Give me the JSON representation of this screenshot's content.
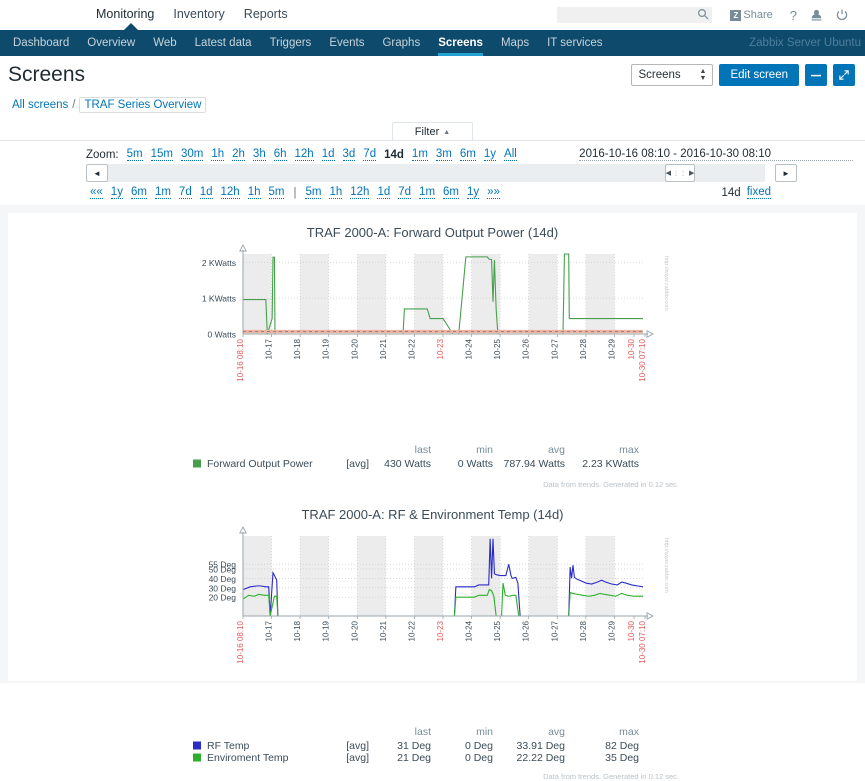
{
  "topnav": {
    "items": [
      {
        "label": "Monitoring",
        "active": true
      },
      {
        "label": "Inventory",
        "active": false
      },
      {
        "label": "Reports",
        "active": false
      }
    ],
    "search": {
      "value": "",
      "placeholder": ""
    },
    "share_label": "Share",
    "share_badge": "Z",
    "help_icon": "?",
    "user_icon": "user-icon",
    "power_icon": "power-icon"
  },
  "navbar": {
    "items": [
      {
        "label": "Dashboard",
        "active": false
      },
      {
        "label": "Overview",
        "active": false
      },
      {
        "label": "Web",
        "active": false
      },
      {
        "label": "Latest data",
        "active": false
      },
      {
        "label": "Triggers",
        "active": false
      },
      {
        "label": "Events",
        "active": false
      },
      {
        "label": "Graphs",
        "active": false
      },
      {
        "label": "Screens",
        "active": true
      },
      {
        "label": "Maps",
        "active": false
      },
      {
        "label": "IT services",
        "active": false
      }
    ],
    "server": "Zabbix Server Ubuntu"
  },
  "page": {
    "title": "Screens",
    "select_value": "Screens",
    "edit_button": "Edit screen",
    "collapse_icon": "minus-icon",
    "fullscreen_icon": "expand-icon"
  },
  "breadcrumb": {
    "all_screens": "All screens",
    "separator": "/",
    "current": "TRAF Series Overview"
  },
  "filter": {
    "tab_label": "Filter",
    "tab_caret": "▲",
    "zoom_label": "Zoom:",
    "zoom_options": [
      {
        "label": "5m",
        "current": false
      },
      {
        "label": "15m",
        "current": false
      },
      {
        "label": "30m",
        "current": false
      },
      {
        "label": "1h",
        "current": false
      },
      {
        "label": "2h",
        "current": false
      },
      {
        "label": "3h",
        "current": false
      },
      {
        "label": "6h",
        "current": false
      },
      {
        "label": "12h",
        "current": false
      },
      {
        "label": "1d",
        "current": false
      },
      {
        "label": "3d",
        "current": false
      },
      {
        "label": "7d",
        "current": false
      },
      {
        "label": "14d",
        "current": true
      },
      {
        "label": "1m",
        "current": false
      },
      {
        "label": "3m",
        "current": false
      },
      {
        "label": "6m",
        "current": false
      },
      {
        "label": "1y",
        "current": false
      },
      {
        "label": "All",
        "current": false
      }
    ],
    "period": "2016-10-16 08:10 - 2016-10-30 08:10",
    "scroll_left_icon": "◄",
    "scroll_right_icon": "►",
    "nav_back_all": "««",
    "nav_back": [
      "1y",
      "6m",
      "1m",
      "7d",
      "1d",
      "12h",
      "1h",
      "5m"
    ],
    "nav_divider": "|",
    "nav_fwd": [
      "5m",
      "1h",
      "12h",
      "1d",
      "7d",
      "1m",
      "6m",
      "1y"
    ],
    "nav_fwd_all": "»»",
    "current_range": "14d",
    "fixed_label": "fixed"
  },
  "chart_data": [
    {
      "type": "line",
      "title": "TRAF 2000-A: Forward Output Power (14d)",
      "xlabel": "",
      "ylabel": "",
      "ylim": [
        0,
        2230
      ],
      "yticks": [
        {
          "value": 0,
          "label": "0 Watts"
        },
        {
          "value": 1000,
          "label": "1 KWatts"
        },
        {
          "value": 2000,
          "label": "2 KWatts"
        }
      ],
      "xticks": [
        "10-16 08:10",
        "10-17",
        "10-18",
        "10-19",
        "10-20",
        "10-21",
        "10-22",
        "10-23",
        "10-24",
        "10-25",
        "10-26",
        "10-27",
        "10-28",
        "10-29",
        "10-30",
        "10-30 07:10"
      ],
      "grid": true,
      "legend_position": "bottom",
      "series": [
        {
          "name": "Forward Output Power",
          "color": "#46a04b",
          "agg": "[avg]",
          "last": "430 Watts",
          "min": "0 Watts",
          "avg": "787.94 Watts",
          "max": "2.23 KWatts",
          "points": [
            [
              0.0,
              960
            ],
            [
              0.8,
              960
            ],
            [
              0.85,
              0
            ],
            [
              1.02,
              430
            ],
            [
              1.05,
              2140
            ],
            [
              1.1,
              2140
            ],
            [
              1.12,
              0
            ],
            [
              5.6,
              0
            ],
            [
              5.65,
              700
            ],
            [
              6.45,
              700
            ],
            [
              6.55,
              430
            ],
            [
              7.0,
              430
            ],
            [
              7.35,
              0
            ],
            [
              7.55,
              0
            ],
            [
              7.8,
              2150
            ],
            [
              8.55,
              2150
            ],
            [
              8.62,
              2080
            ],
            [
              8.7,
              2080
            ],
            [
              8.75,
              900
            ],
            [
              8.8,
              2060
            ],
            [
              8.86,
              700
            ],
            [
              8.92,
              0
            ],
            [
              9.0,
              0
            ],
            [
              9.0,
              0
            ],
            [
              11.2,
              0
            ],
            [
              11.25,
              2230
            ],
            [
              11.4,
              2230
            ],
            [
              11.42,
              430
            ],
            [
              13.6,
              430
            ],
            [
              14.0,
              430
            ]
          ]
        }
      ],
      "stat_headers": [
        "last",
        "min",
        "avg",
        "max"
      ],
      "footnote": "Data from trends. Generated in 0.12 sec.",
      "watermark": "http://www.zabbix.com"
    },
    {
      "type": "line",
      "title": "TRAF 2000-A: RF & Environment Temp (14d)",
      "xlabel": "",
      "ylabel": "",
      "ylim": [
        0,
        85
      ],
      "yticks": [
        {
          "value": 20,
          "label": "20 Deg"
        },
        {
          "value": 30,
          "label": "30 Deg"
        },
        {
          "value": 40,
          "label": "40 Deg"
        },
        {
          "value": 50,
          "label": "50 Deg"
        },
        {
          "value": 55,
          "label": "55 Deg"
        }
      ],
      "xticks": [
        "10-16 08:10",
        "10-17",
        "10-18",
        "10-19",
        "10-20",
        "10-21",
        "10-22",
        "10-23",
        "10-24",
        "10-25",
        "10-26",
        "10-27",
        "10-28",
        "10-29",
        "10-30",
        "10-30 07:10"
      ],
      "grid": true,
      "legend_position": "bottom",
      "series": [
        {
          "name": "RF Temp",
          "color": "#2b2bc8",
          "agg": "[avg]",
          "last": "31 Deg",
          "min": "0 Deg",
          "avg": "33.91 Deg",
          "max": "82 Deg",
          "points": [
            [
              0.0,
              28
            ],
            [
              0.25,
              31
            ],
            [
              0.5,
              32
            ],
            [
              0.6,
              32
            ],
            [
              0.8,
              31
            ],
            [
              0.9,
              31
            ],
            [
              0.95,
              0
            ],
            [
              1.05,
              46
            ],
            [
              1.12,
              42
            ],
            [
              1.18,
              38
            ],
            [
              1.22,
              0
            ],
            [
              7.4,
              0
            ],
            [
              7.45,
              31
            ],
            [
              8.1,
              31
            ],
            [
              8.25,
              33
            ],
            [
              8.6,
              33
            ],
            [
              8.65,
              82
            ],
            [
              8.7,
              40
            ],
            [
              8.75,
              82
            ],
            [
              8.8,
              45
            ],
            [
              8.85,
              44
            ],
            [
              9.0,
              43
            ],
            [
              9.2,
              43
            ],
            [
              9.3,
              55
            ],
            [
              9.38,
              43
            ],
            [
              9.42,
              40
            ],
            [
              9.55,
              41
            ],
            [
              9.62,
              35
            ],
            [
              9.7,
              0
            ],
            [
              11.4,
              0
            ],
            [
              11.45,
              52
            ],
            [
              11.5,
              40
            ],
            [
              11.55,
              54
            ],
            [
              11.6,
              41
            ],
            [
              11.7,
              39
            ],
            [
              11.85,
              37
            ],
            [
              12.0,
              35
            ],
            [
              12.2,
              34
            ],
            [
              12.4,
              36
            ],
            [
              12.55,
              38
            ],
            [
              12.7,
              36
            ],
            [
              12.9,
              34
            ],
            [
              13.1,
              33
            ],
            [
              13.25,
              36
            ],
            [
              13.4,
              35
            ],
            [
              13.6,
              33
            ],
            [
              13.8,
              32
            ],
            [
              14.0,
              31
            ]
          ]
        },
        {
          "name": "Enviroment Temp",
          "color": "#2bb02b",
          "agg": "[avg]",
          "last": "21 Deg",
          "min": "0 Deg",
          "avg": "22.22 Deg",
          "max": "35 Deg",
          "points": [
            [
              0.0,
              18
            ],
            [
              0.2,
              22
            ],
            [
              0.4,
              21
            ],
            [
              0.55,
              23
            ],
            [
              0.75,
              22
            ],
            [
              0.9,
              22
            ],
            [
              0.95,
              0
            ],
            [
              1.1,
              21
            ],
            [
              1.18,
              21
            ],
            [
              1.22,
              0
            ],
            [
              7.4,
              0
            ],
            [
              7.45,
              20
            ],
            [
              8.1,
              20
            ],
            [
              8.25,
              22
            ],
            [
              8.55,
              22
            ],
            [
              8.62,
              28
            ],
            [
              8.7,
              27
            ],
            [
              8.78,
              21
            ],
            [
              8.86,
              0
            ],
            [
              9.05,
              0
            ],
            [
              9.1,
              35
            ],
            [
              9.18,
              22
            ],
            [
              9.3,
              21
            ],
            [
              9.45,
              22
            ],
            [
              9.55,
              22
            ],
            [
              9.65,
              0
            ],
            [
              11.4,
              0
            ],
            [
              11.45,
              25
            ],
            [
              11.55,
              24
            ],
            [
              11.7,
              23
            ],
            [
              11.9,
              22
            ],
            [
              12.1,
              21
            ],
            [
              12.3,
              22
            ],
            [
              12.5,
              24
            ],
            [
              12.65,
              23
            ],
            [
              12.85,
              22
            ],
            [
              13.05,
              21
            ],
            [
              13.25,
              24
            ],
            [
              13.45,
              22
            ],
            [
              13.7,
              21
            ],
            [
              14.0,
              21
            ]
          ]
        }
      ],
      "stat_headers": [
        "last",
        "min",
        "avg",
        "max"
      ],
      "footnote": "Data from trends. Generated in 0.12 sec.",
      "watermark": "http://www.zabbix.com"
    }
  ]
}
